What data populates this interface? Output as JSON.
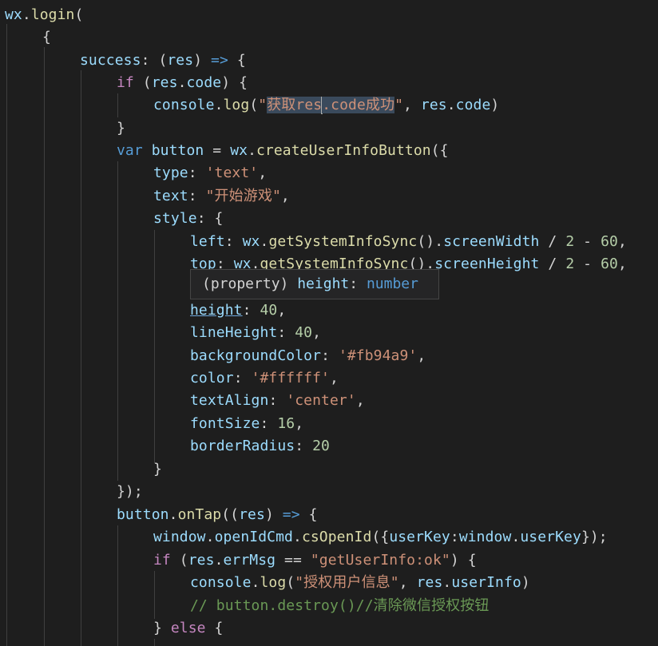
{
  "code": {
    "l1": {
      "a": "wx",
      "b": ".",
      "c": "login",
      "d": "("
    },
    "l2": {
      "a": "{"
    },
    "l3": {
      "a": "success",
      ":": ": ",
      "p1": "(",
      "v": "res",
      "p2": ")",
      "arrow": " =>",
      "b": " {"
    },
    "l4": {
      "kw": "if",
      "p1": " (",
      "v1": "res",
      "dot": ".",
      "v2": "code",
      "p2": ") {"
    },
    "l5": {
      "a": "console",
      "dot": ".",
      "b": "log",
      "p": "(",
      "s1": "\"",
      "s2": "获取",
      "s3": "res",
      "s4": ".code成功",
      "s5": "\"",
      "c": ", ",
      "v1": "res",
      "dot2": ".",
      "v2": "code",
      "e": ")"
    },
    "l6": {
      "a": "}"
    },
    "l7": {
      "kw": "var",
      "sp": " ",
      "v": "button",
      "eq": " = ",
      "o": "wx",
      "dot": ".",
      "f": "createUserInfoButton",
      "e": "({"
    },
    "l8": {
      "k": "type",
      ":": ": ",
      "s": "'text'",
      "c": ","
    },
    "l9": {
      "k": "text",
      ":": ": ",
      "s": "\"开始游戏\"",
      "c": ","
    },
    "l10": {
      "k": "style",
      ":": ": {"
    },
    "l11": {
      "k": "left",
      ":": ": ",
      "o": "wx",
      "dot": ".",
      "f": "getSystemInfoSync",
      "p": "().",
      "v": "screenWidth",
      "op": " / ",
      "n1": "2",
      "m": " - ",
      "n2": "60",
      "c": ","
    },
    "l12": {
      "k": "top",
      ":": ": ",
      "o": "wx",
      "dot": ".",
      "f": "getSystemInfoSync",
      "p": "().",
      "v": "screenHeight",
      "op": " / ",
      "n1": "2",
      "m": " - ",
      "n2": "60",
      "c": ","
    },
    "l14": {
      "k": "height",
      ":": ": ",
      "n": "40",
      "c": ","
    },
    "l15": {
      "k": "lineHeight",
      ":": ": ",
      "n": "40",
      "c": ","
    },
    "l16": {
      "k": "backgroundColor",
      ":": ": ",
      "s": "'#fb94a9'",
      "c": ","
    },
    "l17": {
      "k": "color",
      ":": ": ",
      "s": "'#ffffff'",
      "c": ","
    },
    "l18": {
      "k": "textAlign",
      ":": ": ",
      "s": "'center'",
      "c": ","
    },
    "l19": {
      "k": "fontSize",
      ":": ": ",
      "n": "16",
      "c": ","
    },
    "l20": {
      "k": "borderRadius",
      ":": ": ",
      "n": "20"
    },
    "l21": {
      "a": "}"
    },
    "l22": {
      "a": "});"
    },
    "l23": {
      "o": "button",
      "dot": ".",
      "f": "onTap",
      "p": "((",
      "v": "res",
      "p2": ")",
      "arrow": " =>",
      "b": " {"
    },
    "l24": {
      "o": "window",
      "dot": ".",
      "o2": "openIdCmd",
      "dot2": ".",
      "f": "csOpenId",
      "p": "({",
      "k": "userKey",
      ":": ":",
      "o3": "window",
      "dot3": ".",
      "v": "userKey",
      "e": "});"
    },
    "l25": {
      "kw": "if",
      "p1": " (",
      "v1": "res",
      "dot": ".",
      "v2": "errMsg",
      "eq": " == ",
      "s": "\"getUserInfo:ok\"",
      "p2": ") {"
    },
    "l26": {
      "a": "console",
      "dot": ".",
      "b": "log",
      "p": "(",
      "s": "\"授权用户信息\"",
      "c": ", ",
      "v1": "res",
      "dot2": ".",
      "v2": "userInfo",
      "e": ")"
    },
    "l27": {
      "com": "// button.destroy()//清除微信授权按钮"
    },
    "l28": {
      "b": "} ",
      "kw": "else",
      "e": " {"
    }
  },
  "hover": {
    "p": "(property)",
    "sp": " ",
    "k": "height",
    ":": ": ",
    "t": "number"
  }
}
